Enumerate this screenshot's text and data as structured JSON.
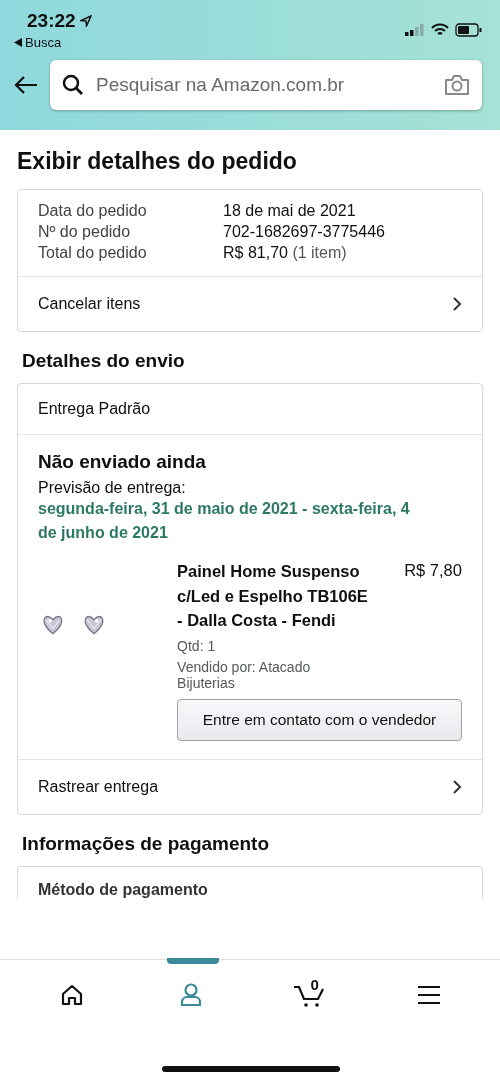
{
  "status_bar": {
    "time": "23:22",
    "back_label": "Busca"
  },
  "search": {
    "placeholder": "Pesquisar na Amazon.com.br"
  },
  "page_title": "Exibir detalhes do pedido",
  "order_summary": {
    "rows": [
      {
        "label": "Data do pedido",
        "value": "18 de mai de 2021"
      },
      {
        "label": "Nº do pedido",
        "value": "702-1682697-3775446"
      },
      {
        "label": "Total do pedido",
        "value": "R$ 81,70",
        "note": "(1 item)"
      }
    ],
    "action": "Cancelar itens"
  },
  "shipping": {
    "heading": "Detalhes do envio",
    "method": "Entrega Padrão",
    "status": "Não enviado ainda",
    "estimate_label": "Previsão de entrega:",
    "estimate": "segunda-feira, 31 de maio de 2021 - sexta-feira, 4 de junho de 2021",
    "item": {
      "title": "Painel Home Suspenso c/Led e Espelho TB106E - Dalla Costa - Fendi",
      "price": "R$ 7,80",
      "quantity": "Qtd: 1",
      "seller": "Vendido por: Atacado Bijuterias",
      "contact_button": "Entre em contato com o vendedor"
    },
    "track": "Rastrear entrega"
  },
  "payment": {
    "heading": "Informações de pagamento",
    "method_label": "Método de pagamento"
  },
  "bottom_nav": [
    {
      "kind": "home",
      "selected": false
    },
    {
      "kind": "account",
      "selected": true
    },
    {
      "kind": "cart",
      "selected": false,
      "count": "0"
    },
    {
      "kind": "menu",
      "selected": false
    }
  ]
}
